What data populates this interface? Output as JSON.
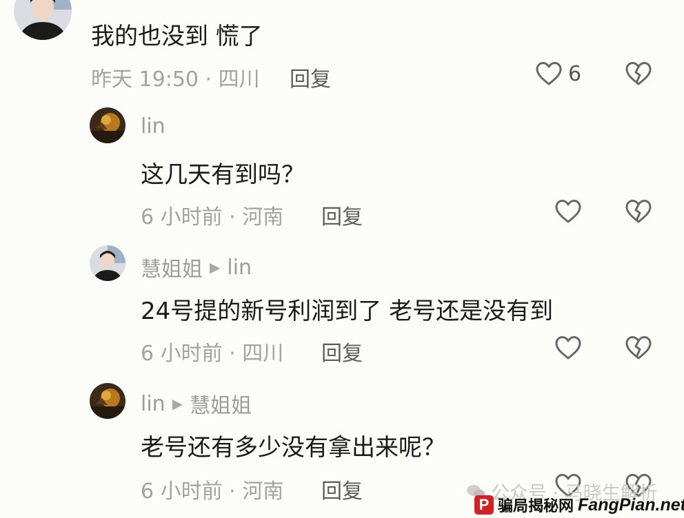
{
  "comments": [
    {
      "text": "我的也没到 慌了",
      "meta": "昨天 19:50 · 四川",
      "reply": "回复",
      "like_count": "6"
    },
    {
      "username": "lin",
      "text": "这几天有到吗？",
      "meta": "6 小时前 · 河南",
      "reply": "回复"
    },
    {
      "username": "慧姐姐",
      "reply_to": "lin",
      "text": "24号提的新号利润到了 老号还是没有到",
      "meta": "6 小时前 · 四川",
      "reply": "回复"
    },
    {
      "username": "lin",
      "reply_to": "慧姐姐",
      "text": "老号还有多少没有拿出来呢？",
      "meta": "6 小时前 · 河南",
      "reply": "回复"
    }
  ],
  "watermark": {
    "account": "公众号 · 马晓生解析",
    "site_cn": "骗局揭秘网",
    "site_en": "FangPian.net",
    "badge": "P"
  },
  "colors": {
    "background": "#fcfcf8",
    "text": "#1a1a1a",
    "meta": "#a2a2a2",
    "icon": "#666666",
    "badge": "#d42020"
  }
}
